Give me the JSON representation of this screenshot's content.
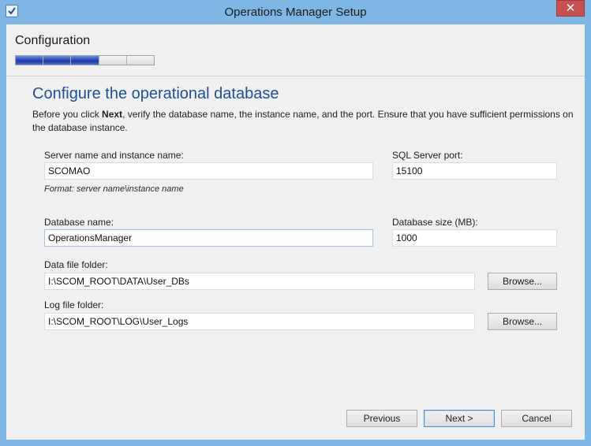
{
  "window": {
    "title": "Operations Manager Setup",
    "close_glyph": "✕"
  },
  "header": {
    "section_title": "Configuration",
    "progress": {
      "completed_steps": 3,
      "total_steps": 5
    }
  },
  "page": {
    "title": "Configure the operational database",
    "intro_before": "Before you click ",
    "intro_bold": "Next",
    "intro_after": ", verify the database name, the instance name, and the port. Ensure that you have sufficient permissions on the database instance."
  },
  "form": {
    "server_label": "Server name and instance name:",
    "server_value": "SCOMAO",
    "server_hint": "Format: server name\\instance name",
    "port_label": "SQL Server port:",
    "port_value": "15100",
    "db_name_label": "Database name:",
    "db_name_value": "OperationsManager",
    "db_size_label": "Database size (MB):",
    "db_size_value": "1000",
    "data_folder_label": "Data file folder:",
    "data_folder_value": "I:\\SCOM_ROOT\\DATA\\User_DBs",
    "log_folder_label": "Log file folder:",
    "log_folder_value": "I:\\SCOM_ROOT\\LOG\\User_Logs",
    "browse_label": "Browse..."
  },
  "footer": {
    "previous_label": "Previous",
    "next_label": "Next >",
    "cancel_label": "Cancel"
  },
  "colors": {
    "title_blue": "#1f4e9a",
    "frame": "#7fb6e4",
    "close_red": "#c75050",
    "progress_fill": "#1d3aa6"
  },
  "icons": [
    "setup-app-icon",
    "close-icon"
  ]
}
